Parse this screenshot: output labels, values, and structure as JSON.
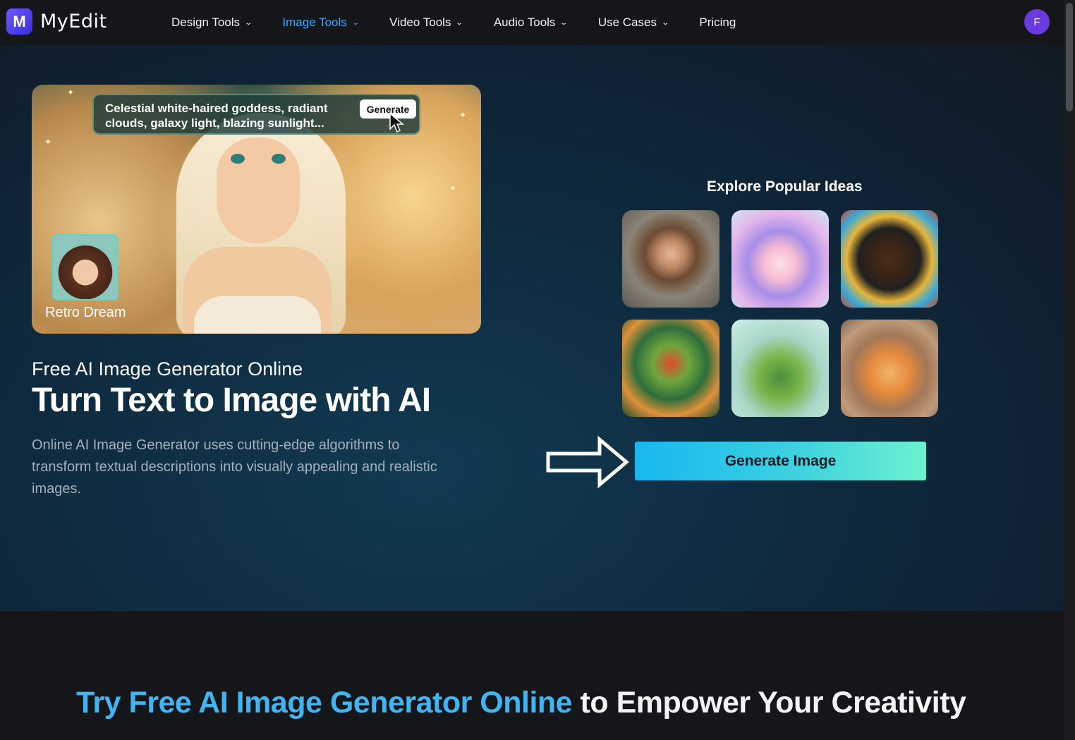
{
  "brand": {
    "name": "MyEdit",
    "logo_letter": "M"
  },
  "nav": {
    "items": [
      {
        "label": "Design Tools",
        "has_dropdown": true,
        "active": false
      },
      {
        "label": "Image Tools",
        "has_dropdown": true,
        "active": true
      },
      {
        "label": "Video Tools",
        "has_dropdown": true,
        "active": false
      },
      {
        "label": "Audio Tools",
        "has_dropdown": true,
        "active": false
      },
      {
        "label": "Use Cases",
        "has_dropdown": true,
        "active": false
      },
      {
        "label": "Pricing",
        "has_dropdown": false,
        "active": false
      }
    ],
    "avatar_initial": "F"
  },
  "hero": {
    "prompt_text": "Celestial white-haired goddess, radiant clouds, galaxy light, blazing sunlight...",
    "prompt_button": "Generate",
    "style_label": "Retro Dream",
    "subtitle": "Free AI Image Generator Online",
    "title": "Turn Text to Image with AI",
    "description": "Online AI Image Generator uses cutting-edge algorithms to transform textual descriptions into visually appealing and realistic images."
  },
  "explore": {
    "title": "Explore Popular Ideas",
    "ideas": [
      {
        "icon": "woman-portrait-image"
      },
      {
        "icon": "anime-girl-image"
      },
      {
        "icon": "graffiti-man-image"
      },
      {
        "icon": "parrot-image"
      },
      {
        "icon": "floating-island-image"
      },
      {
        "icon": "kitten-image"
      }
    ],
    "generate_button": "Generate Image"
  },
  "bottom": {
    "title_part1": "Try Free AI Image Generator Online",
    "title_part2": " to Empower Your Creativity"
  },
  "colors": {
    "accent_blue": "#3fa9ff",
    "title_blue": "#3fb6f2",
    "button_gradient_start": "#17b7ef",
    "button_gradient_end": "#6cf2cf",
    "avatar": "#6b3be0"
  }
}
